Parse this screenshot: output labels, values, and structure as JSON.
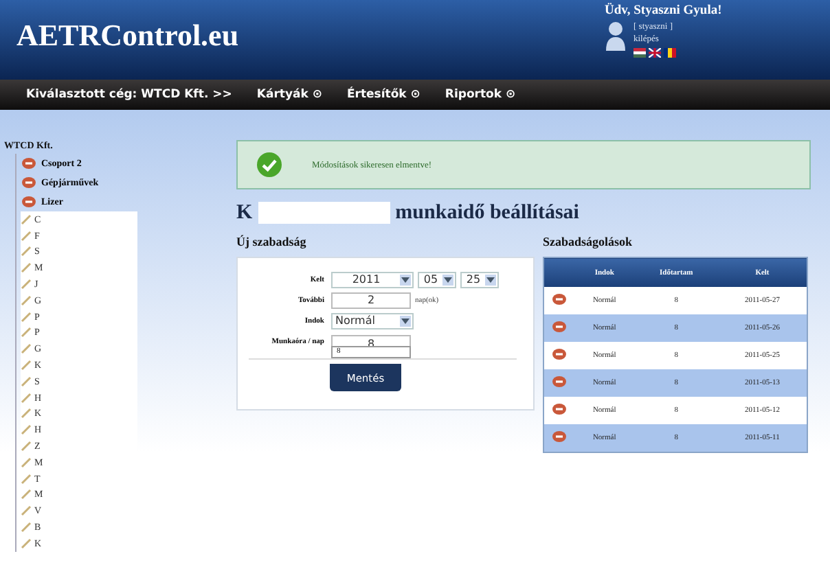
{
  "header": {
    "logo": "AETRControl.eu",
    "greeting": "Üdv, Styaszni Gyula!",
    "username": "[ styaszni ]",
    "logout": "kilépés"
  },
  "nav": [
    "Kiválasztott cég: WTCD Kft. >>",
    "Kártyák ⊙",
    "Értesítők ⊙",
    "Riportok ⊙"
  ],
  "sidebar": {
    "root": "WTCD Kft.",
    "groups": [
      {
        "label": "Csoport 2"
      },
      {
        "label": "Gépjárművek"
      },
      {
        "label": "Lizer",
        "children": [
          "C",
          "F",
          "S",
          "M",
          "J",
          "G",
          "P",
          "P",
          "G",
          "K",
          "S",
          "H",
          "K",
          "H",
          "Z",
          "M",
          "T",
          "M",
          "V",
          "B",
          "K"
        ]
      }
    ]
  },
  "message": "Módosítások sikeresen elmentve!",
  "title": {
    "start": "K",
    "end": "munkaidő beállításai"
  },
  "form": {
    "heading": "Új szabadság",
    "date_label": "Kelt",
    "year": "2011",
    "month": "05",
    "day": "25",
    "more_label": "További",
    "more_value": "2",
    "more_unit": "nap(ok)",
    "reason_label": "Indok",
    "reason": "Normál",
    "hours_label": "Munkaóra / nap",
    "hours": "8",
    "suggestion": "8",
    "save": "Mentés"
  },
  "table": {
    "heading": "Szabadságolások",
    "columns": [
      "Indok",
      "Időtartam",
      "Kelt"
    ],
    "rows": [
      {
        "reason": "Normál",
        "hours": "8",
        "date": "2011-05-27"
      },
      {
        "reason": "Normál",
        "hours": "8",
        "date": "2011-05-26"
      },
      {
        "reason": "Normál",
        "hours": "8",
        "date": "2011-05-25"
      },
      {
        "reason": "Normál",
        "hours": "8",
        "date": "2011-05-13"
      },
      {
        "reason": "Normál",
        "hours": "8",
        "date": "2011-05-12"
      },
      {
        "reason": "Normál",
        "hours": "8",
        "date": "2011-05-11"
      }
    ]
  }
}
